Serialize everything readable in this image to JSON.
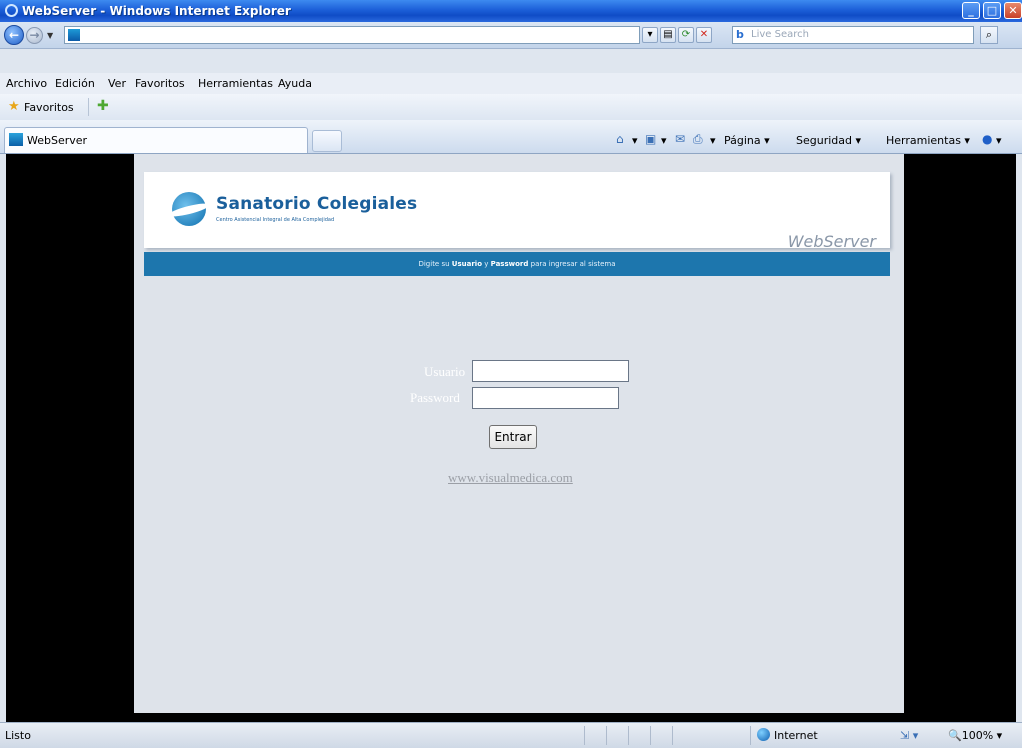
{
  "window": {
    "title": "WebServer - Windows Internet Explorer"
  },
  "search": {
    "placeholder": "Live Search"
  },
  "menu": [
    "Archivo",
    "Edición",
    "Ver",
    "Favoritos",
    "Herramientas",
    "Ayuda"
  ],
  "favorites": {
    "label": "Favoritos"
  },
  "tab": {
    "label": "WebServer"
  },
  "commandbar": {
    "pagina": "Página",
    "seguridad": "Seguridad",
    "herramientas": "Herramientas"
  },
  "page": {
    "brand": "Sanatorio Colegiales",
    "brand_sub": "Centro Asistencial Integral de Alta Complejidad",
    "webserver": "WebServer",
    "instruction_pre": "Digite su",
    "instruction_user": "Usuario",
    "instruction_mid": "y",
    "instruction_pass": "Password",
    "instruction_post": "para ingresar al sistema",
    "user_label": "Usuario",
    "password_label": "Password",
    "button": "Entrar",
    "site": "www.visualmedica.com"
  },
  "status": {
    "text": "Listo",
    "zone": "Internet",
    "zoom": "100%"
  },
  "colors": {
    "accent_bar": "#1d76ad",
    "titlebar": "#1c5fd8"
  }
}
